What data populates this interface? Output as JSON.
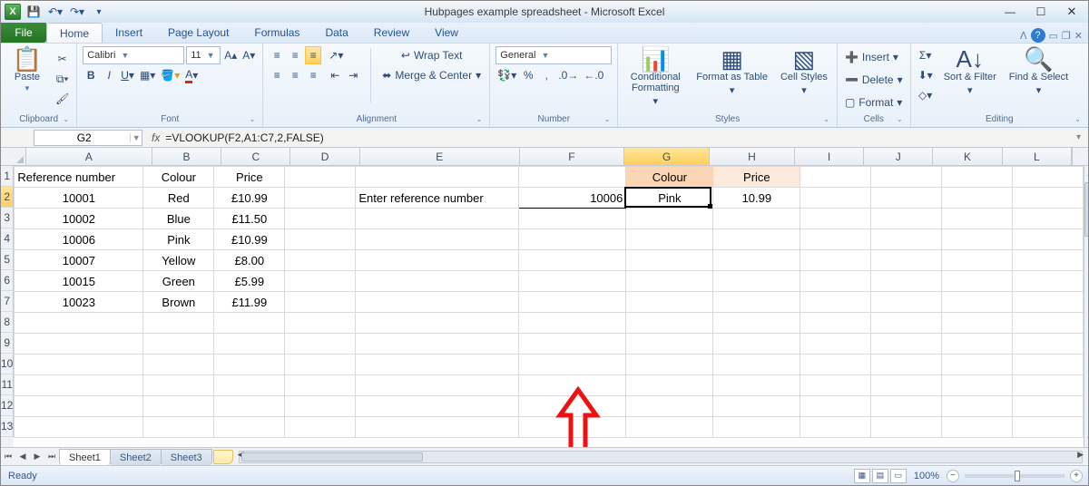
{
  "window": {
    "document_title": "Hubpages example spreadsheet",
    "app_name": "Microsoft Excel"
  },
  "tabs": {
    "file": "File",
    "list": [
      "Home",
      "Insert",
      "Page Layout",
      "Formulas",
      "Data",
      "Review",
      "View"
    ],
    "active": 0
  },
  "ribbon": {
    "clipboard": {
      "label": "Clipboard",
      "paste": "Paste"
    },
    "font": {
      "label": "Font",
      "name": "Calibri",
      "size": "11"
    },
    "alignment": {
      "label": "Alignment",
      "wrap": "Wrap Text",
      "merge": "Merge & Center"
    },
    "number": {
      "label": "Number",
      "format": "General"
    },
    "styles": {
      "label": "Styles",
      "cond": "Conditional Formatting",
      "ftbl": "Format as Table",
      "cell": "Cell Styles"
    },
    "cells": {
      "label": "Cells",
      "insert": "Insert",
      "delete": "Delete",
      "format": "Format"
    },
    "editing": {
      "label": "Editing",
      "sort": "Sort & Filter",
      "find": "Find & Select"
    }
  },
  "formula_bar": {
    "name": "G2",
    "formula": "=VLOOKUP(F2,A1:C7,2,FALSE)"
  },
  "columns": [
    "A",
    "B",
    "C",
    "D",
    "E",
    "F",
    "G",
    "H",
    "I",
    "J",
    "K",
    "L"
  ],
  "rows_visible": 13,
  "selected_cell": {
    "col_index": 6,
    "row_index": 1
  },
  "headers": {
    "A1": "Reference number",
    "B1": "Colour",
    "C1": "Price",
    "G1": "Colour",
    "H1": "Price",
    "E2": "Enter reference number"
  },
  "lookup": {
    "input_F2": "10006",
    "result_G2": "Pink",
    "result_H2": "10.99"
  },
  "data": [
    {
      "ref": "10001",
      "colour": "Red",
      "price": "£10.99"
    },
    {
      "ref": "10002",
      "colour": "Blue",
      "price": "£11.50"
    },
    {
      "ref": "10006",
      "colour": "Pink",
      "price": "£10.99"
    },
    {
      "ref": "10007",
      "colour": "Yellow",
      "price": "£8.00"
    },
    {
      "ref": "10015",
      "colour": "Green",
      "price": "£5.99"
    },
    {
      "ref": "10023",
      "colour": "Brown",
      "price": "£11.99"
    }
  ],
  "sheets": [
    "Sheet1",
    "Sheet2",
    "Sheet3"
  ],
  "active_sheet": 0,
  "status": {
    "ready": "Ready",
    "zoom": "100%"
  }
}
